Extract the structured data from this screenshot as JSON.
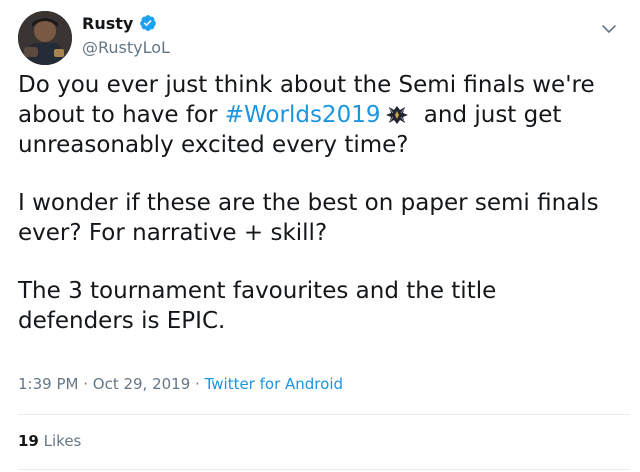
{
  "author": {
    "display_name": "Rusty",
    "handle": "@RustyLoL",
    "verified": true
  },
  "tweet": {
    "line1_pre": "Do you ever just think about the Semi finals we're about to have for ",
    "hashtag": "#Worlds2019",
    "line1_post": " and just get unreasonably excited every time?",
    "paragraph2": "I wonder if these are the best on paper semi finals ever? For narrative + skill?",
    "paragraph3": "The 3 tournament favourites and the title defenders is EPIC."
  },
  "meta": {
    "time": "1:39 PM",
    "date": "Oct 29, 2019",
    "separator": " · ",
    "source": "Twitter for Android"
  },
  "stats": {
    "likes_count": "19",
    "likes_label": "Likes"
  },
  "colors": {
    "link": "#1b95e0",
    "muted": "#657786",
    "text": "#14171a",
    "verified": "#1da1f2"
  },
  "icons": {
    "verified": "verified-badge-icon",
    "caret": "chevron-down-icon",
    "hashtag_emoji": "worlds-trophy-icon"
  }
}
